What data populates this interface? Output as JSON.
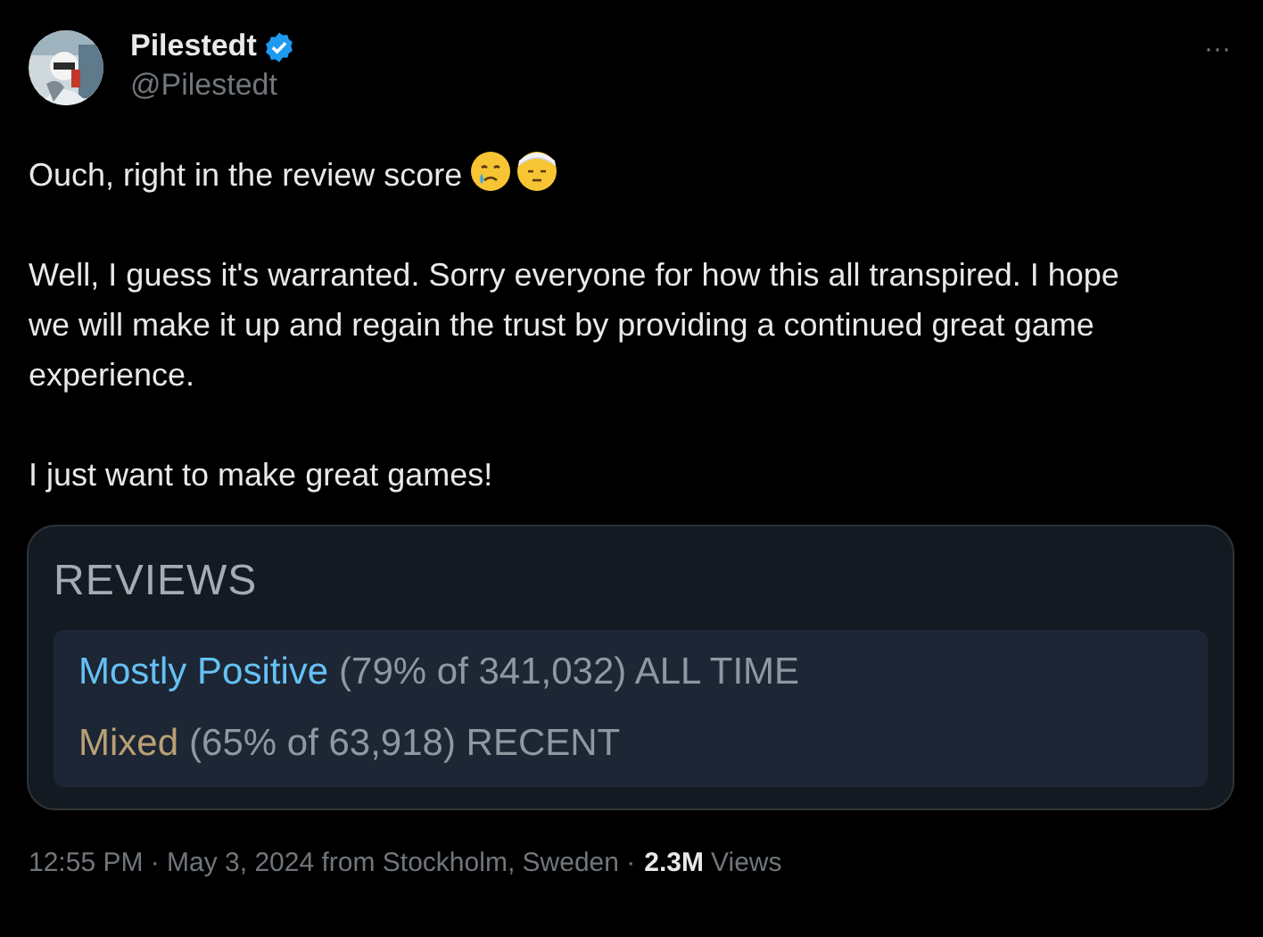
{
  "author": {
    "name": "Pilestedt",
    "verified": true,
    "handle": "@Pilestedt"
  },
  "more_button": "···",
  "paragraphs": [
    {
      "text": "Ouch, right in the review score",
      "icons": [
        {
          "kind": "crying"
        },
        {
          "kind": "bandaged"
        }
      ]
    },
    {
      "text": "Well, I guess it's warranted. Sorry everyone for how this all transpired. I hope we will make it up and regain the trust by providing a continued great game experience."
    },
    {
      "text": "I just want to make great games!"
    }
  ],
  "reviews_card": {
    "title": "REVIEWS",
    "rows": [
      {
        "rating": "Mostly Positive",
        "color": "#66c0f4",
        "detail": "(79% of 341,032) ALL TIME"
      },
      {
        "rating": "Mixed",
        "color": "#b9a074",
        "detail": "(65% of 63,918) RECENT"
      }
    ]
  },
  "footer": {
    "meta": "12:55 PM · May 3, 2024 from Stockholm, Sweden ·",
    "views_count": "2.3M",
    "views_label": "Views"
  }
}
